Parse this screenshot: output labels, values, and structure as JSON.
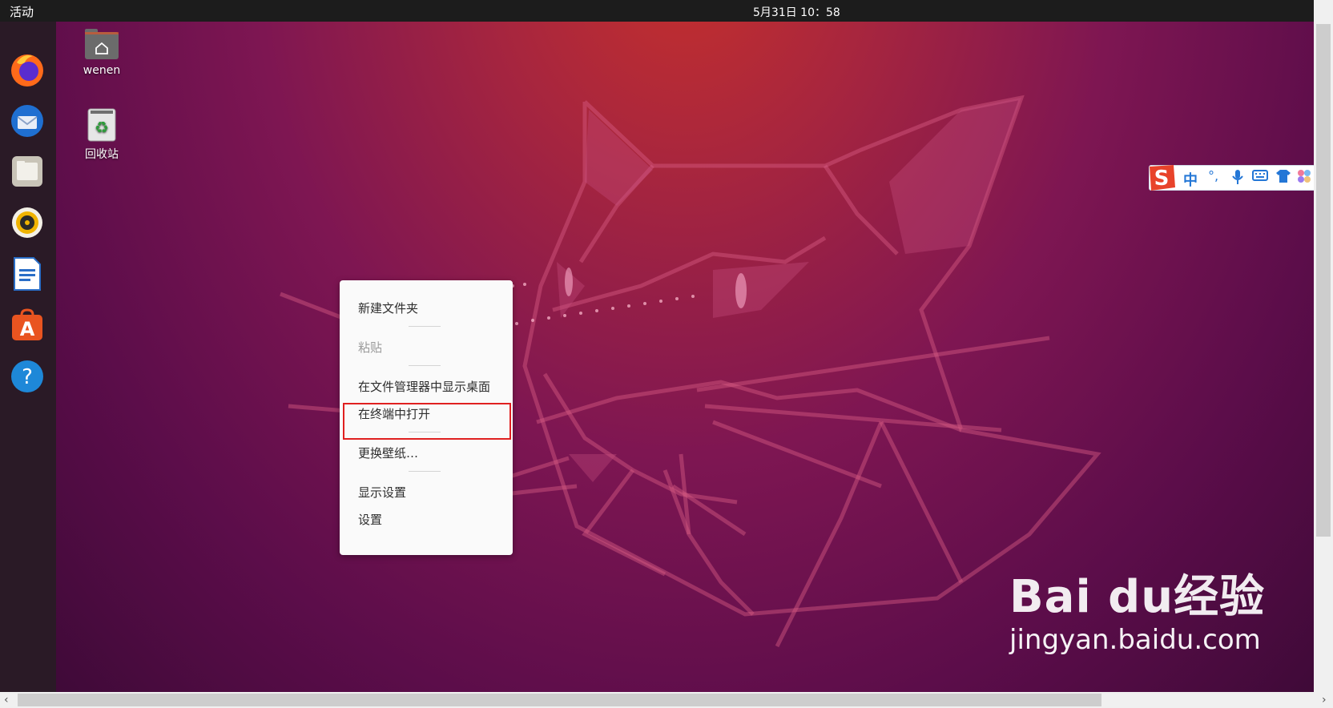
{
  "topbar": {
    "activities": "活动",
    "clock": "5月31日 10：58"
  },
  "dock": {
    "items": [
      {
        "name": "firefox-icon"
      },
      {
        "name": "thunderbird-icon"
      },
      {
        "name": "files-icon"
      },
      {
        "name": "rhythmbox-icon"
      },
      {
        "name": "libreoffice-writer-icon"
      },
      {
        "name": "software-store-icon"
      },
      {
        "name": "help-icon"
      }
    ]
  },
  "desktop": {
    "home_folder": {
      "label": "wenen",
      "icon": "home-folder-icon"
    },
    "trash": {
      "label": "回收站",
      "icon": "trash-icon"
    }
  },
  "context_menu": {
    "new_folder": "新建文件夹",
    "paste": "粘贴",
    "show_in_files": "在文件管理器中显示桌面",
    "open_in_terminal": "在终端中打开",
    "change_wallpaper": "更换壁纸…",
    "display_settings": "显示设置",
    "settings": "设置"
  },
  "ime_toolbar": {
    "logo": "S",
    "mode": "中",
    "punct": "°,",
    "icons": [
      "microphone-icon",
      "keyboard-icon",
      "skin-icon",
      "toolbox-icon"
    ]
  },
  "watermark": {
    "brand": "Bai du经验",
    "url": "jingyan.baidu.com"
  },
  "colors": {
    "menu_highlight_border": "#e02020",
    "ime_accent": "#2477d6",
    "ubuntu_orange": "#e95420"
  }
}
